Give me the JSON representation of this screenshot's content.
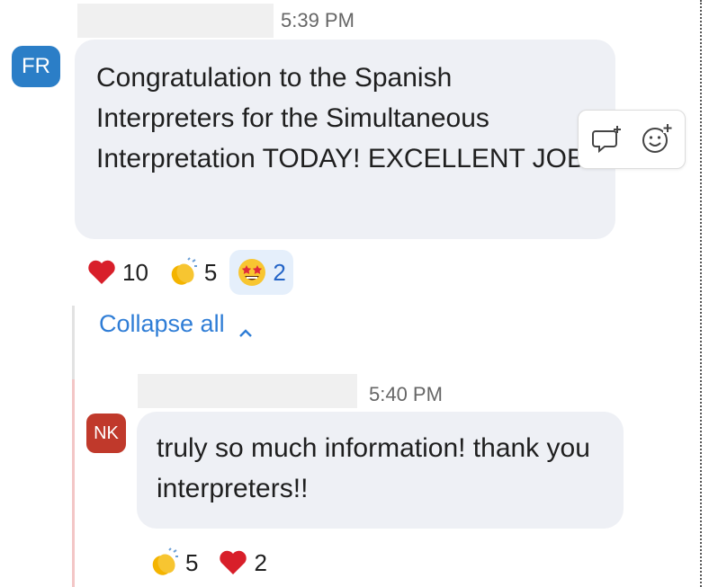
{
  "messages": [
    {
      "avatar": "FR",
      "time": "5:39 PM",
      "text": "Congratulation to the Spanish Interpreters for the Simultaneous Interpretation TODAY! EXCELLENT JOB!",
      "reactions": [
        {
          "icon": "heart-icon",
          "count": "10"
        },
        {
          "icon": "clapping-hands-icon",
          "count": "5"
        },
        {
          "icon": "star-struck-icon",
          "count": "2"
        }
      ]
    },
    {
      "avatar": "NK",
      "time": "5:40 PM",
      "text": "truly so much information! thank you interpreters!!",
      "reactions": [
        {
          "icon": "clapping-hands-icon",
          "count": "5"
        },
        {
          "icon": "heart-icon",
          "count": "2"
        }
      ]
    }
  ],
  "thread": {
    "collapse_label": "Collapse all"
  },
  "hover_actions": [
    "reply-icon",
    "add-reaction-icon"
  ],
  "colors": {
    "fr_avatar": "#2b7ec7",
    "nk_avatar": "#c0392b",
    "link": "#2f7dd6",
    "active_reaction_bg": "#e5effb"
  }
}
